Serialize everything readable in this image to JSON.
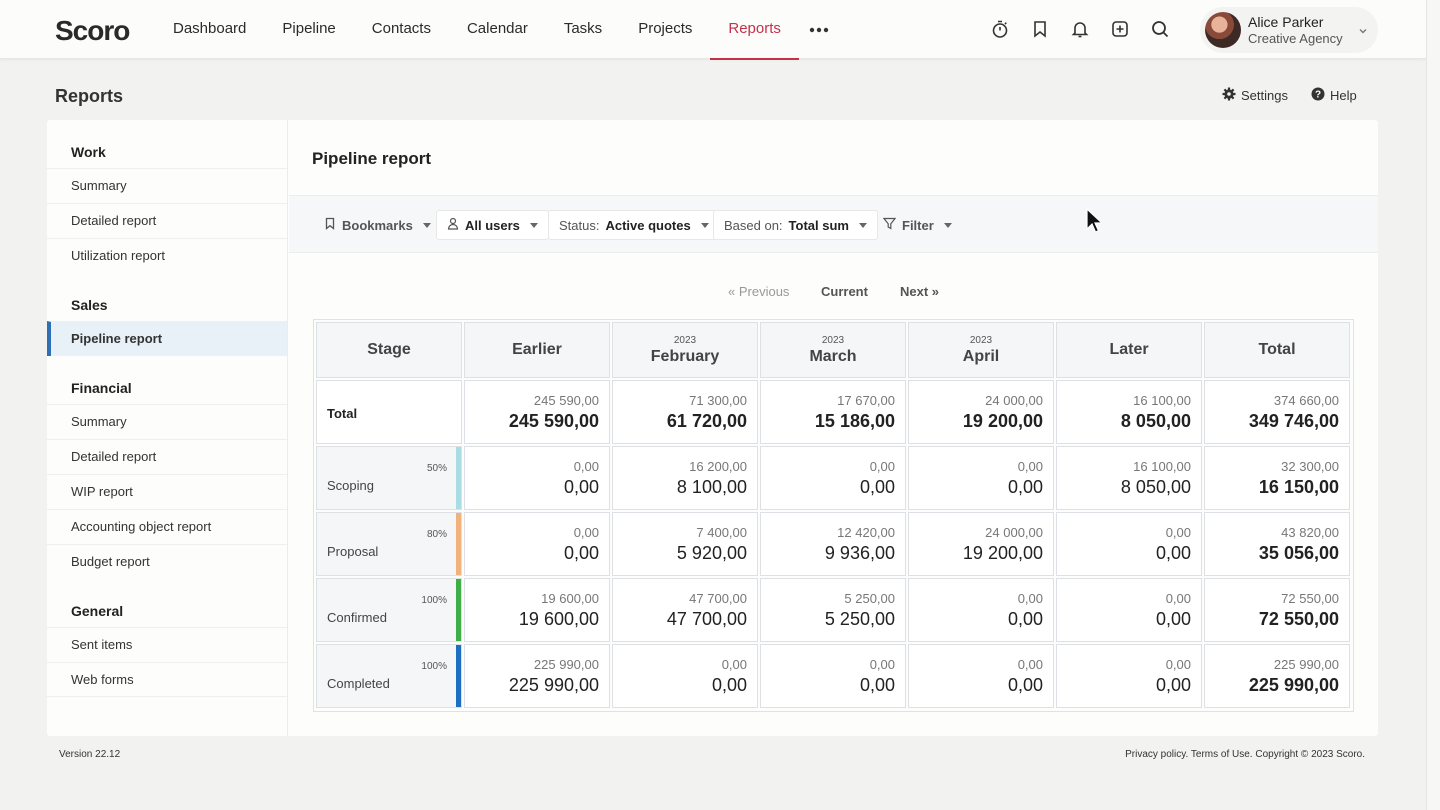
{
  "brand": {
    "logo": "Scoro"
  },
  "nav": {
    "items": [
      {
        "label": "Dashboard"
      },
      {
        "label": "Pipeline"
      },
      {
        "label": "Contacts"
      },
      {
        "label": "Calendar"
      },
      {
        "label": "Tasks"
      },
      {
        "label": "Projects"
      },
      {
        "label": "Reports",
        "active": true
      }
    ],
    "more_icon": "more-horizontal-icon"
  },
  "top_icons": [
    "timer-icon",
    "bookmark-icon",
    "bell-icon",
    "add-icon",
    "search-icon"
  ],
  "user": {
    "name": "Alice Parker",
    "org": "Creative Agency"
  },
  "page": {
    "title": "Reports",
    "settings_label": "Settings",
    "help_label": "Help"
  },
  "sidebar": {
    "sections": [
      {
        "title": "Work",
        "items": [
          "Summary",
          "Detailed report",
          "Utilization report"
        ]
      },
      {
        "title": "Sales",
        "items": [
          "Pipeline report"
        ]
      },
      {
        "title": "Financial",
        "items": [
          "Summary",
          "Detailed report",
          "WIP report",
          "Accounting object report",
          "Budget report"
        ]
      },
      {
        "title": "General",
        "items": [
          "Sent items",
          "Web forms"
        ]
      }
    ],
    "active_item": "Pipeline report"
  },
  "report": {
    "title": "Pipeline report",
    "toolbar": {
      "bookmarks": "Bookmarks",
      "users": "All users",
      "status_label": "Status:",
      "status_value": "Active quotes",
      "based_label": "Based on:",
      "based_value": "Total sum",
      "filter": "Filter"
    },
    "pager": {
      "previous": "« Previous",
      "current": "Current",
      "next": "Next »"
    },
    "columns": [
      {
        "label": "Stage",
        "year": ""
      },
      {
        "label": "Earlier",
        "year": ""
      },
      {
        "label": "February",
        "year": "2023"
      },
      {
        "label": "March",
        "year": "2023"
      },
      {
        "label": "April",
        "year": "2023"
      },
      {
        "label": "Later",
        "year": ""
      },
      {
        "label": "Total",
        "year": ""
      }
    ],
    "total_row": {
      "label": "Total",
      "values": [
        {
          "top": "245 590,00",
          "main": "245 590,00"
        },
        {
          "top": "71 300,00",
          "main": "61 720,00"
        },
        {
          "top": "17 670,00",
          "main": "15 186,00"
        },
        {
          "top": "24 000,00",
          "main": "19 200,00"
        },
        {
          "top": "16 100,00",
          "main": "8 050,00"
        },
        {
          "top": "374 660,00",
          "main": "349 746,00"
        }
      ]
    },
    "rows": [
      {
        "stage": "Scoping",
        "pct": "50%",
        "color": "#a8dde6",
        "values": [
          {
            "top": "0,00",
            "main": "0,00"
          },
          {
            "top": "16 200,00",
            "main": "8 100,00"
          },
          {
            "top": "0,00",
            "main": "0,00"
          },
          {
            "top": "0,00",
            "main": "0,00"
          },
          {
            "top": "16 100,00",
            "main": "8 050,00"
          },
          {
            "top": "32 300,00",
            "main": "16 150,00"
          }
        ]
      },
      {
        "stage": "Proposal",
        "pct": "80%",
        "color": "#f3b27c",
        "values": [
          {
            "top": "0,00",
            "main": "0,00"
          },
          {
            "top": "7 400,00",
            "main": "5 920,00"
          },
          {
            "top": "12 420,00",
            "main": "9 936,00"
          },
          {
            "top": "24 000,00",
            "main": "19 200,00"
          },
          {
            "top": "0,00",
            "main": "0,00"
          },
          {
            "top": "43 820,00",
            "main": "35 056,00"
          }
        ]
      },
      {
        "stage": "Confirmed",
        "pct": "100%",
        "color": "#3fae49",
        "values": [
          {
            "top": "19 600,00",
            "main": "19 600,00"
          },
          {
            "top": "47 700,00",
            "main": "47 700,00"
          },
          {
            "top": "5 250,00",
            "main": "5 250,00"
          },
          {
            "top": "0,00",
            "main": "0,00"
          },
          {
            "top": "0,00",
            "main": "0,00"
          },
          {
            "top": "72 550,00",
            "main": "72 550,00"
          }
        ]
      },
      {
        "stage": "Completed",
        "pct": "100%",
        "color": "#1e6fc4",
        "values": [
          {
            "top": "225 990,00",
            "main": "225 990,00"
          },
          {
            "top": "0,00",
            "main": "0,00"
          },
          {
            "top": "0,00",
            "main": "0,00"
          },
          {
            "top": "0,00",
            "main": "0,00"
          },
          {
            "top": "0,00",
            "main": "0,00"
          },
          {
            "top": "225 990,00",
            "main": "225 990,00"
          }
        ]
      }
    ]
  },
  "footer": {
    "version": "Version 22.12",
    "legal": "Privacy policy. Terms of Use. Copyright © 2023 Scoro."
  }
}
